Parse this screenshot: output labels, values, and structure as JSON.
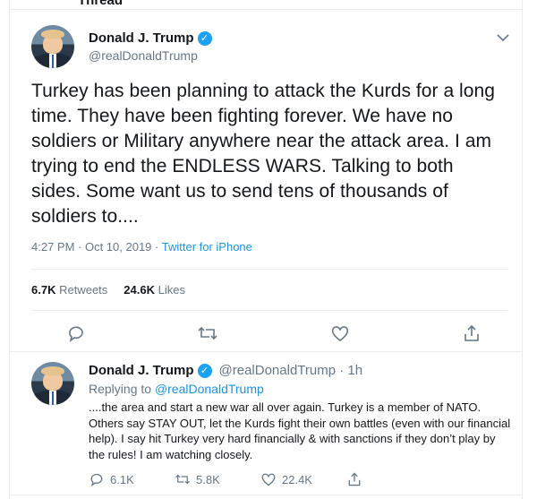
{
  "header": {
    "cut_text": "Thread"
  },
  "tweet": {
    "name": "Donald J. Trump",
    "handle": "@realDonaldTrump",
    "text": "Turkey has been planning to attack the Kurds for a long time. They have been fighting forever. We have no soldiers or Military anywhere near the attack area. I am trying to end the ENDLESS WARS. Talking to both sides. Some want us to send tens of thousands of soldiers to....",
    "time": "4:27 PM · Oct 10, 2019 · ",
    "source": "Twitter for iPhone",
    "retweets_count": "6.7K",
    "retweets_label": "Retweets",
    "likes_count": "24.6K",
    "likes_label": "Likes"
  },
  "reply": {
    "name": "Donald J. Trump",
    "handle": "@realDonaldTrump · 1h",
    "replying_prefix": "Replying to ",
    "replying_to": "@realDonaldTrump",
    "text": "....the area and start a new war all over again. Turkey is a member of NATO. Others say STAY OUT, let the Kurds fight their own battles (even with our financial help). I say hit Turkey very hard financially & with sanctions if they don’t play by the rules! I am watching closely.",
    "reply_count": "6.1K",
    "retweet_count": "5.8K",
    "like_count": "22.4K"
  },
  "icons": [
    "chevron-down-icon",
    "verified-icon",
    "reply-icon",
    "retweet-icon",
    "like-icon",
    "share-icon"
  ],
  "colors": {
    "accent": "#1da1f2",
    "link": "#1b95e0",
    "muted": "#657786",
    "border": "#e6ecf0"
  }
}
